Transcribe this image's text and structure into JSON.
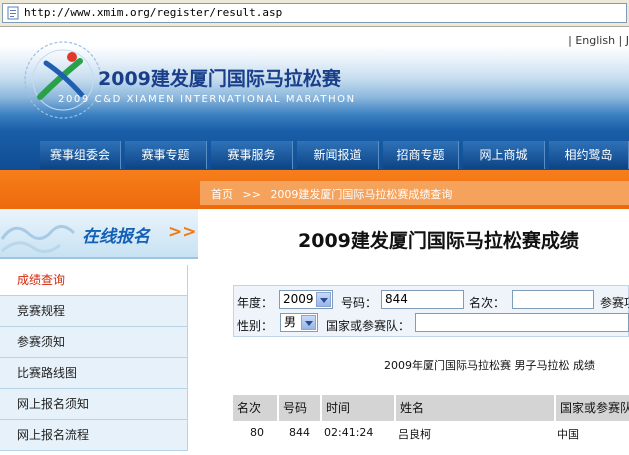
{
  "address_bar": {
    "url": "http://www.xmim.org/register/result.asp"
  },
  "header": {
    "top_links": "| English | J",
    "title_cn": "2009建发厦门国际马拉松赛",
    "title_en": "2009 C&D XIAMEN INTERNATIONAL MARATHON",
    "nav": [
      "赛事组委会",
      "赛事专题",
      "赛事服务",
      "新闻报道",
      "招商专题",
      "网上商城",
      "相约鹭岛"
    ]
  },
  "breadcrumb": {
    "home": "首页",
    "separator": ">>",
    "current": "2009建发厦门国际马拉松赛成绩查询"
  },
  "sidebar": {
    "banner_label": "在线报名",
    "banner_arrows": ">>",
    "items": [
      "成绩查询",
      "竞赛规程",
      "参赛须知",
      "比赛路线图",
      "网上报名须知",
      "网上报名流程"
    ]
  },
  "main": {
    "page_title": "2009建发厦门国际马拉松赛成绩",
    "search": {
      "year_label": "年度：",
      "year_value": "2009",
      "number_label": "号码：",
      "number_value": "844",
      "rank_label": "名次：",
      "rank_value": "",
      "category_label": "参赛项",
      "gender_label": "性别：",
      "gender_value": "男",
      "country_label": "国家或参赛队：",
      "country_value": ""
    },
    "result_caption": "2009年厦门国际马拉松赛  男子马拉松  成绩",
    "table": {
      "headers": [
        "名次",
        "号码",
        "时间",
        "姓名",
        "国家或参赛队"
      ],
      "rows": [
        {
          "rank": "80",
          "number": "844",
          "time": "02:41:24",
          "name": "吕良柯",
          "country": "中国"
        }
      ]
    }
  }
}
